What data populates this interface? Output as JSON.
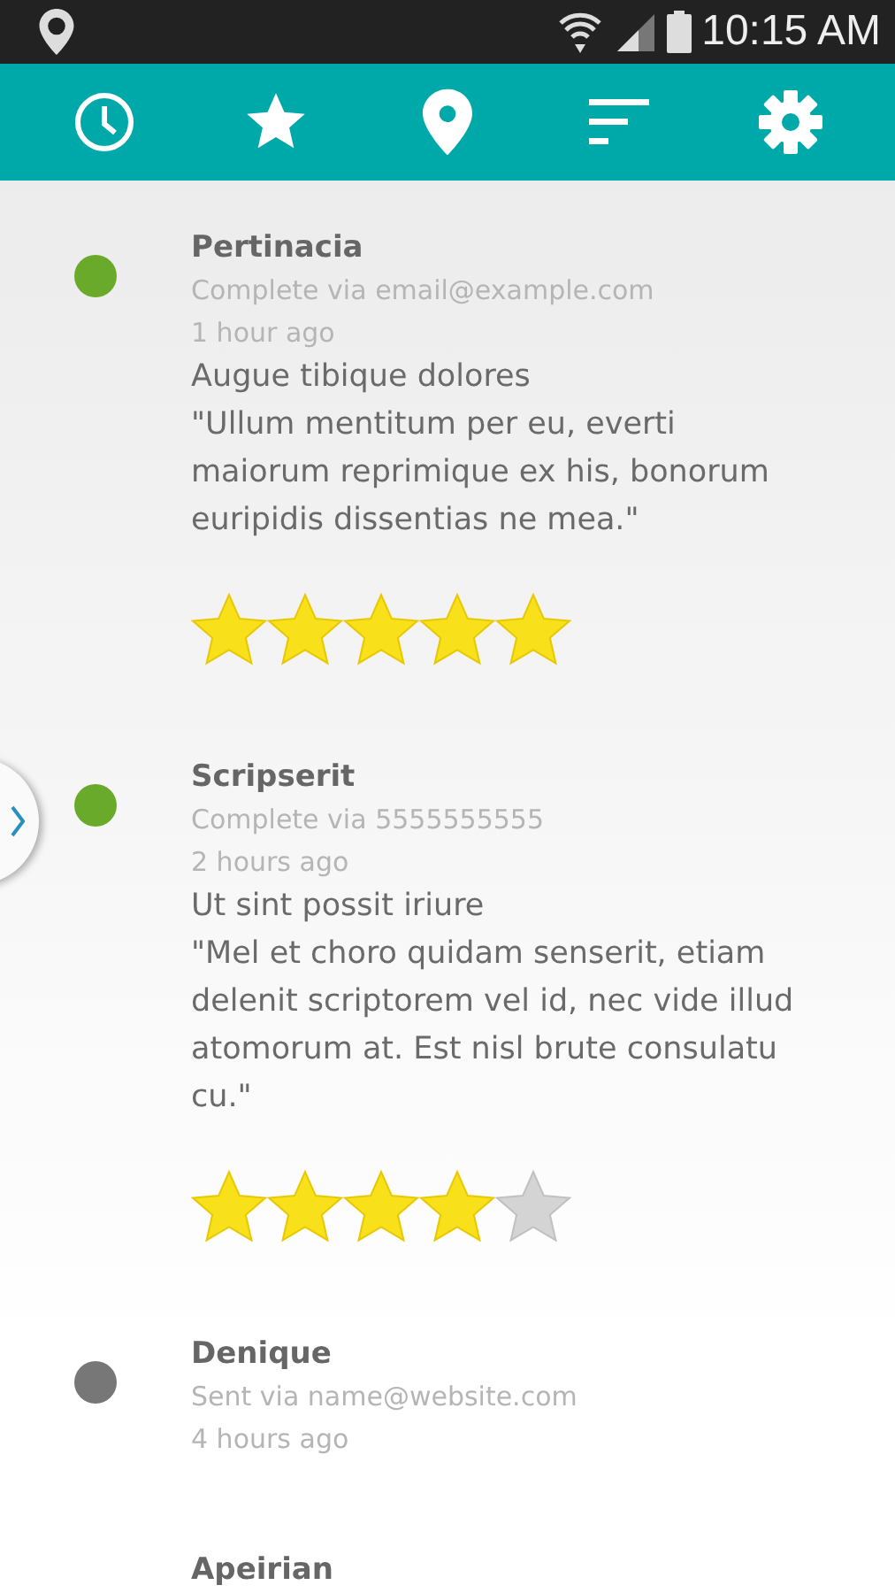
{
  "status_bar": {
    "time": "10:15 AM"
  },
  "toolbar": {
    "icons": [
      {
        "kind": "clock"
      },
      {
        "kind": "star"
      },
      {
        "kind": "pin"
      },
      {
        "kind": "sort"
      },
      {
        "kind": "gear"
      }
    ]
  },
  "feed": [
    {
      "name": "Pertinacia",
      "via": "Complete via email@example.com",
      "time": "1 hour ago",
      "color": "#6aaa2a",
      "title": "Augue tibique dolores",
      "quote": "\"Ullum mentitum per eu, everti maiorum reprimique ex his, bonorum euripidis dissentias ne mea.\"",
      "stars": 5
    },
    {
      "name": "Scripserit",
      "via": "Complete via 5555555555",
      "time": "2 hours ago",
      "color": "#6aaa2a",
      "title": "Ut sint possit iriure",
      "quote": "\"Mel et choro quidam senserit, etiam delenit scriptorem vel id, nec vide illud atomorum at. Est nisl brute consulatu cu.\"",
      "stars": 4
    },
    {
      "name": "Denique",
      "via": "Sent via name@website.com",
      "time": "4 hours ago",
      "color": "#777777"
    },
    {
      "name": "Apeirian"
    }
  ]
}
